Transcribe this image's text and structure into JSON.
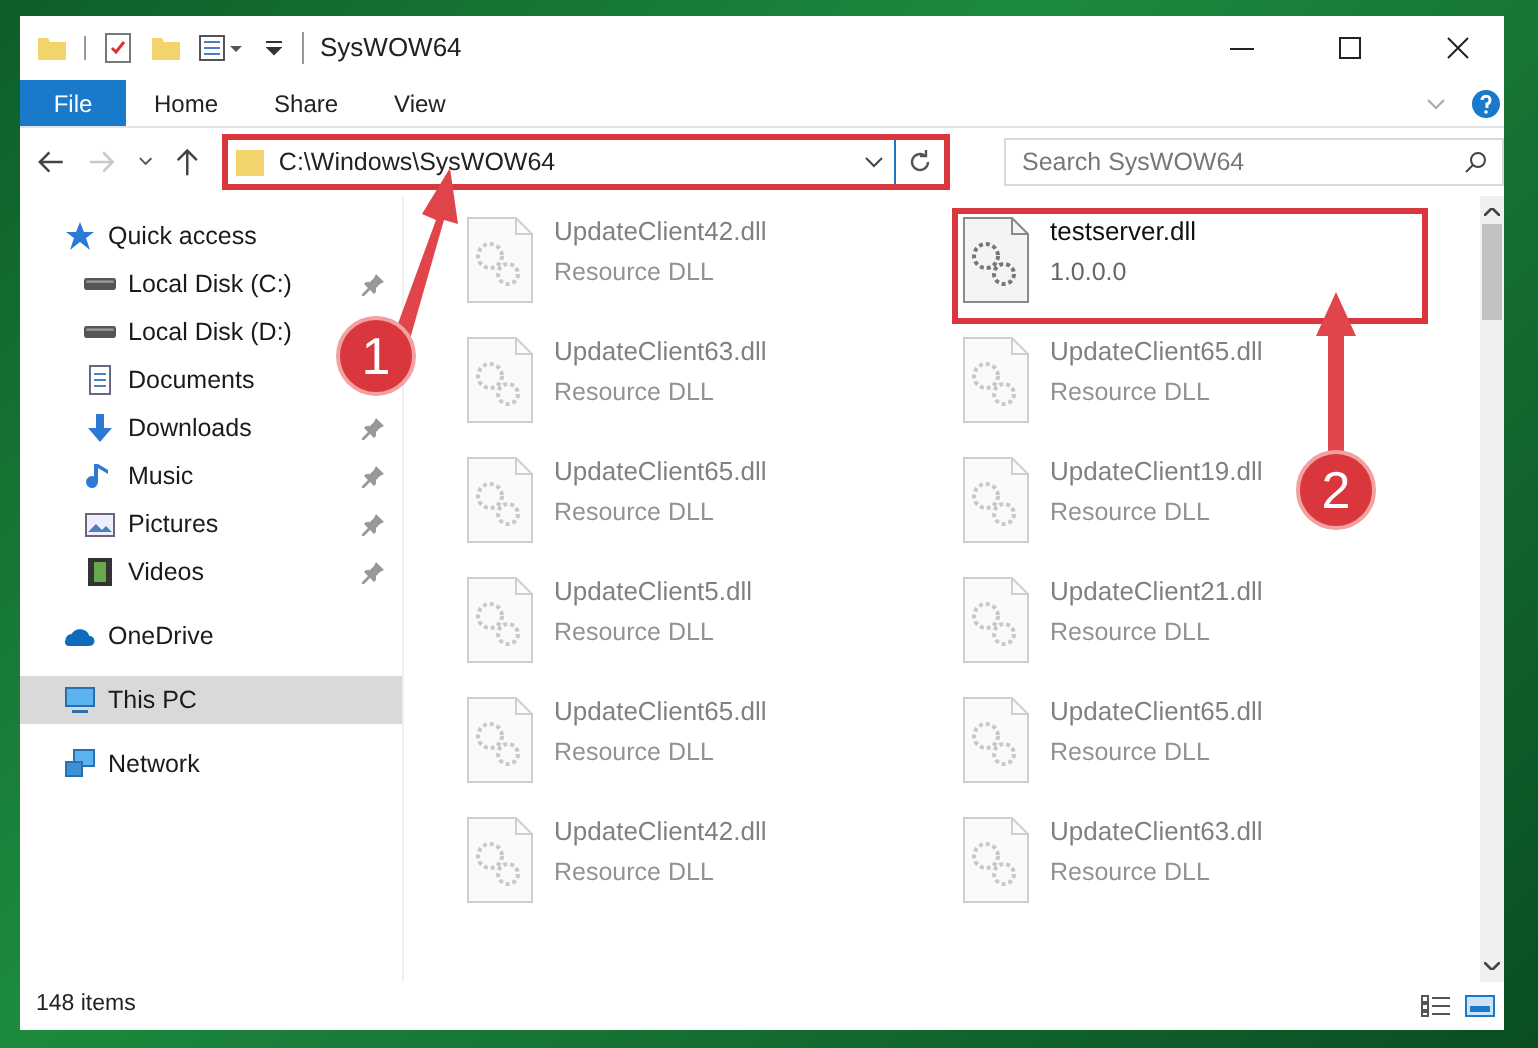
{
  "window": {
    "title": "SysWOW64"
  },
  "ribbon_tabs": [
    {
      "label": "File",
      "selected": true
    },
    {
      "label": "Home",
      "selected": false
    },
    {
      "label": "Share",
      "selected": false
    },
    {
      "label": "View",
      "selected": false
    }
  ],
  "address_bar": {
    "path": "C:\\Windows\\SysWOW64",
    "highlighted": true
  },
  "search": {
    "placeholder": "Search SysWOW64"
  },
  "sidebar": {
    "items": [
      {
        "label": "Quick access",
        "kind": "star",
        "selected": false,
        "children": [
          {
            "label": "Local Disk (C:)",
            "kind": "disk",
            "pinned": true,
            "selected": false
          },
          {
            "label": "Local Disk (D:)",
            "kind": "disk",
            "selected": false
          },
          {
            "label": "Documents",
            "kind": "documents",
            "selected": false
          },
          {
            "label": "Downloads",
            "kind": "download",
            "pinned": true,
            "selected": false
          },
          {
            "label": "Music",
            "kind": "music",
            "pinned": true,
            "selected": false
          },
          {
            "label": "Pictures",
            "kind": "pictures",
            "pinned": true,
            "selected": false
          },
          {
            "label": "Videos",
            "kind": "videos",
            "pinned": true,
            "selected": false
          }
        ]
      },
      {
        "label": "OneDrive",
        "kind": "cloud",
        "selected": false
      },
      {
        "label": "This PC",
        "kind": "pc",
        "selected": true
      },
      {
        "label": "Network",
        "kind": "network",
        "selected": false
      }
    ]
  },
  "files": [
    {
      "name": "UpdateClient42.dll",
      "detail": "Resource DLL",
      "faded": true,
      "highlighted": false
    },
    {
      "name": "testserver.dll",
      "detail": "1.0.0.0",
      "faded": false,
      "highlighted": true
    },
    {
      "name": "UpdateClient63.dll",
      "detail": "Resource DLL",
      "faded": true,
      "highlighted": false
    },
    {
      "name": "UpdateClient65.dll",
      "detail": "Resource DLL",
      "faded": true,
      "highlighted": false
    },
    {
      "name": "UpdateClient65.dll",
      "detail": "Resource DLL",
      "faded": true,
      "highlighted": false
    },
    {
      "name": "UpdateClient19.dll",
      "detail": "Resource DLL",
      "faded": true,
      "highlighted": false
    },
    {
      "name": "UpdateClient5.dll",
      "detail": "Resource DLL",
      "faded": true,
      "highlighted": false
    },
    {
      "name": "UpdateClient21.dll",
      "detail": "Resource DLL",
      "faded": true,
      "highlighted": false
    },
    {
      "name": "UpdateClient65.dll",
      "detail": "Resource DLL",
      "faded": true,
      "highlighted": false
    },
    {
      "name": "UpdateClient65.dll",
      "detail": "Resource DLL",
      "faded": true,
      "highlighted": false
    },
    {
      "name": "UpdateClient42.dll",
      "detail": "Resource DLL",
      "faded": true,
      "highlighted": false
    },
    {
      "name": "UpdateClient63.dll",
      "detail": "Resource DLL",
      "faded": true,
      "highlighted": false
    }
  ],
  "annotations": [
    {
      "label": "1"
    },
    {
      "label": "2"
    }
  ],
  "status_bar": {
    "item_count": "148 items"
  }
}
